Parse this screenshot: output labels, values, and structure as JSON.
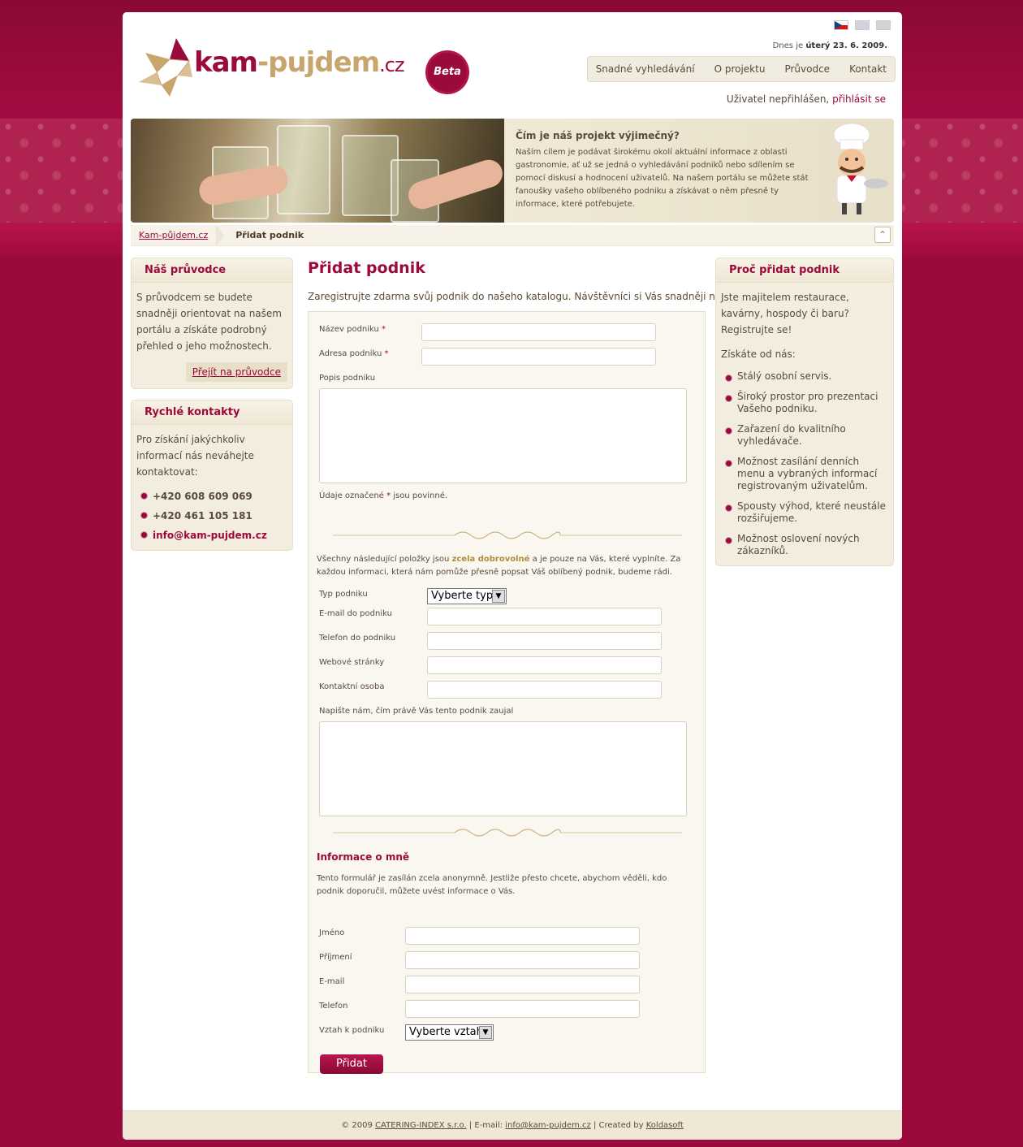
{
  "header": {
    "logo_main": "kam",
    "logo_dash": "-",
    "logo_second": "pujdem",
    "logo_tld": ".cz",
    "beta": "Beta",
    "date_prefix": "Dnes je",
    "date_value": "úterý 23. 6. 2009.",
    "nav": [
      "Snadné vyhledávání",
      "O projektu",
      "Průvodce",
      "Kontakt"
    ],
    "user_status": "Uživatel nepřihlášen,",
    "login_link": "přihlásit se"
  },
  "banner": {
    "title": "Čím je náš projekt výjimečný?",
    "body": "Naším cílem je podávat širokému okolí aktuální informace z oblasti gastronomie, ať už se jedná o vyhledávání podniků nebo sdílením se pomocí diskusí a hodnocení uživatelů. Na našem portálu se můžete stát fanoušky vašeho oblíbeného podniku a získávat o něm přesně ty informace, které potřebujete."
  },
  "breadcrumb": {
    "home": "Kam-půjdem.cz",
    "current": "Přidat podnik"
  },
  "left": {
    "guide": {
      "title": "Náš průvodce",
      "text": "S průvodcem se budete snadněji orientovat na našem portálu a získáte podrobný přehled o jeho možnostech.",
      "link": "Přejít na průvodce"
    },
    "contacts": {
      "title": "Rychlé kontakty",
      "text": "Pro získání jakýchkoliv informací nás neváhejte kontaktovat:",
      "phone1": "+420 608 609 069",
      "phone2": "+420 461 105 181",
      "email": "info@kam-pujdem.cz"
    }
  },
  "main": {
    "title": "Přidat podnik",
    "intro": "Zaregistrujte zdarma svůj podnik do našeho katalogu. Návštěvníci si Vás snadněji najdou.",
    "f_name": "Název podniku",
    "f_address": "Adresa podniku",
    "f_desc": "Popis podniku",
    "required_note_a": "Údaje označené",
    "required_note_b": "jsou povinné.",
    "asterisk": "*",
    "optional_a": "Všechny následující položky jsou",
    "optional_b": "zcela dobrovolné",
    "optional_c": "a je pouze na Vás, které vyplníte. Za každou informaci, která nám pomůže přesně popsat Váš oblíbený podnik, budeme rádi.",
    "f_type": "Typ podniku",
    "f_type_value": "Vyberte typ",
    "f_email": "E-mail do podniku",
    "f_phone": "Telefon do podniku",
    "f_web": "Webové stránky",
    "f_contact": "Kontaktní osoba",
    "f_why": "Napište nám, čím právě Vás tento podnik zaujal",
    "about_title": "Informace o mně",
    "about_text": "Tento formulář je zasílán zcela anonymně. Jestliže přesto chcete, abychom věděli, kdo podnik doporučil, můžete uvést informace o Vás.",
    "f_first": "Jméno",
    "f_last": "Příjmení",
    "f_mail": "E-mail",
    "f_tel": "Telefon",
    "f_rel": "Vztah k podniku",
    "f_rel_value": "Vyberte vztah",
    "submit": "Přidat"
  },
  "right": {
    "title": "Proč přidat podnik",
    "intro": "Jste majitelem restaurace, kavárny, hospody či baru? Registrujte se!",
    "sub": "Získáte od nás:",
    "items": [
      "Stálý osobní servis.",
      "Široký prostor pro prezentaci Vašeho podniku.",
      "Zařazení do kvalitního vyhledávače.",
      "Možnost zasílání denních menu a vybraných informací registrovaným uživatelům.",
      "Spousty výhod, které neustále rozšiřujeme.",
      "Možnost oslovení nových zákazníků."
    ]
  },
  "footer": {
    "copy": "© 2009",
    "company": "CATERING-INDEX s.r.o.",
    "email_label": "| E-mail:",
    "email": "info@kam-pujdem.cz",
    "created": "| Created by",
    "author": "Koldasoft"
  },
  "colors": {
    "brand": "#9b0a3c",
    "gold": "#c8a56d",
    "panel": "#f3eddf"
  }
}
